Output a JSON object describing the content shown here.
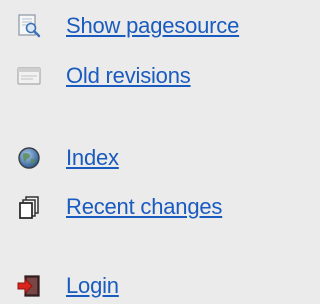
{
  "page_tools": {
    "items": [
      {
        "label": "Show pagesource",
        "icon": "page-source-icon"
      },
      {
        "label": "Old revisions",
        "icon": "revisions-icon"
      }
    ]
  },
  "site_tools": {
    "items": [
      {
        "label": "Index",
        "icon": "globe-icon"
      },
      {
        "label": "Recent changes",
        "icon": "recent-changes-icon"
      }
    ]
  },
  "user_tools": {
    "items": [
      {
        "label": "Login",
        "icon": "login-icon"
      }
    ]
  },
  "colors": {
    "background": "#ebebeb",
    "link": "#1a5bbf"
  }
}
